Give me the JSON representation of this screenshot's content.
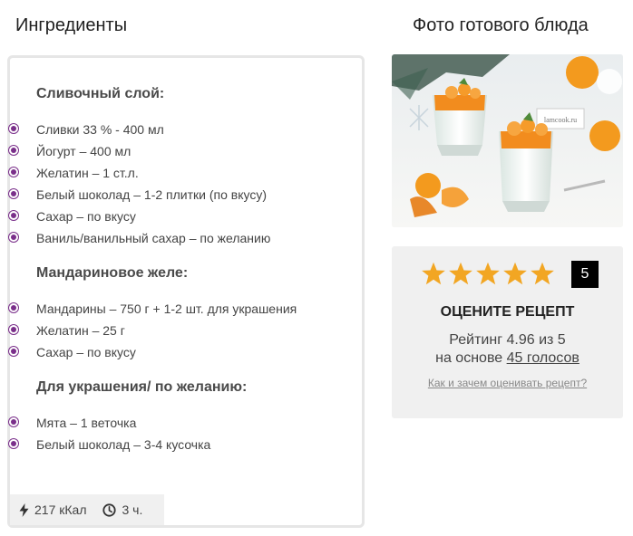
{
  "headings": {
    "ingredients": "Ингредиенты",
    "photo": "Фото готового блюда"
  },
  "groups": [
    {
      "title": "Сливочный слой:",
      "items": [
        "Сливки 33 % - 400 мл",
        "Йогурт – 400 мл",
        "Желатин – 1 ст.л.",
        "Белый шоколад – 1-2 плитки (по вкусу)",
        "Сахар – по вкусу",
        "Ваниль/ванильный сахар – по желанию"
      ]
    },
    {
      "title": "Мандариновое желе:",
      "items": [
        "Мандарины – 750 г + 1-2 шт. для украшения",
        "Желатин – 25 г",
        "Сахар – по вкусу"
      ]
    },
    {
      "title": "Для украшения/ по желанию:",
      "items": [
        "Мята – 1 веточка",
        "Белый шоколад – 3-4 кусочка"
      ]
    }
  ],
  "footer": {
    "calories": "217 кКал",
    "time": "3 ч.",
    "calories_icon": "lightning-icon",
    "time_icon": "clock-icon"
  },
  "photo": {
    "caption_tag": "lamcook.ru"
  },
  "rating": {
    "stars_total": 5,
    "stars_filled": 5,
    "star_color": "#f2a623",
    "vote_value": "5",
    "label": "ОЦЕНИТЕ РЕЦЕПТ",
    "rating_line": "Рейтинг 4.96 из 5",
    "based_prefix": "на основе ",
    "votes_link": "45 голосов",
    "how_link": "Как и зачем оценивать рецепт?"
  },
  "colors": {
    "bullet": "#7a2f8a",
    "card_border": "#e6e6e6",
    "panel_bg": "#f0f0f0"
  }
}
